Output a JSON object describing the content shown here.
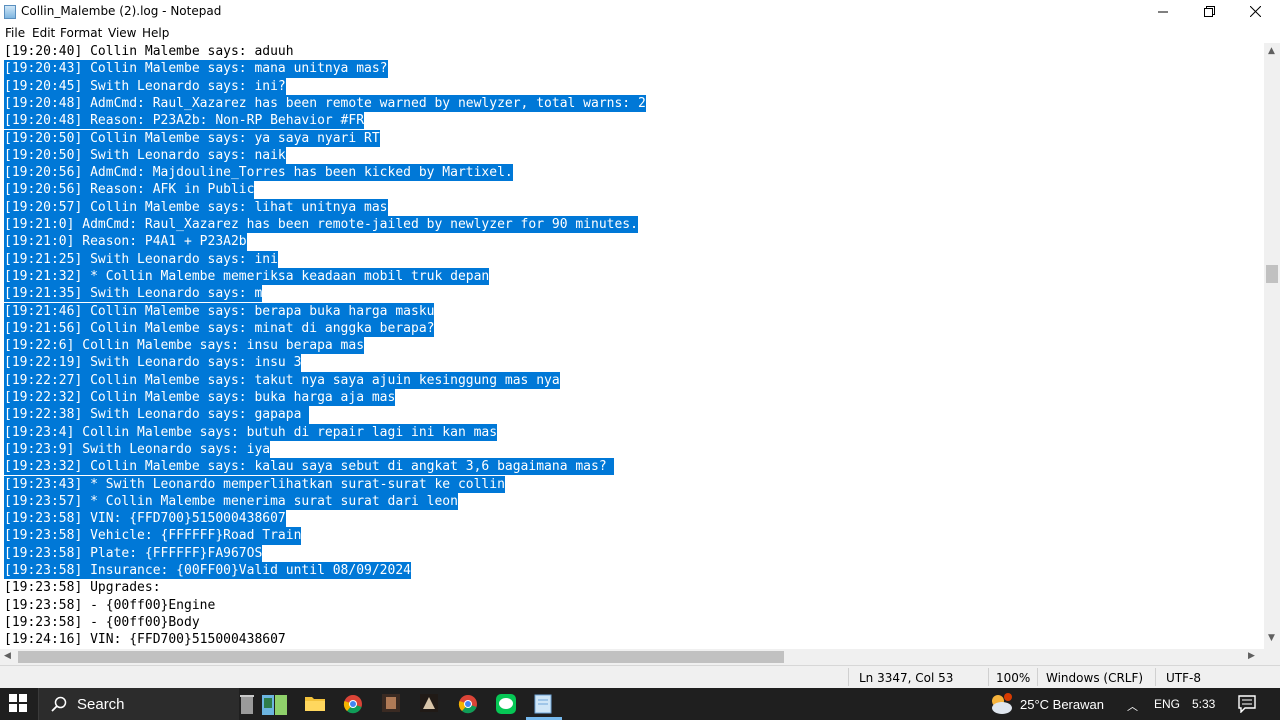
{
  "window": {
    "title": "Collin_Malembe (2).log - Notepad",
    "minimize_icon": "minimize-icon",
    "maximize_icon": "restore-icon",
    "close_icon": "close-icon"
  },
  "menu": [
    "File",
    "Edit",
    "Format",
    "View",
    "Help"
  ],
  "editor": {
    "lines": [
      {
        "text": "[19:20:40] Collin Malembe says: aduuh",
        "selected": false
      },
      {
        "text": "[19:20:43] Collin Malembe says: mana unitnya mas?",
        "selected": true
      },
      {
        "text": "[19:20:45] Swith Leonardo says: ini?",
        "selected": true
      },
      {
        "text": "[19:20:48] AdmCmd: Raul_Xazarez has been remote warned by newlyzer, total warns: 2",
        "selected": true
      },
      {
        "text": "[19:20:48] Reason: P23A2b: Non-RP Behavior #FR",
        "selected": true
      },
      {
        "text": "[19:20:50] Collin Malembe says: ya saya nyari RT",
        "selected": true
      },
      {
        "text": "[19:20:50] Swith Leonardo says: naik",
        "selected": true
      },
      {
        "text": "[19:20:56] AdmCmd: Majdouline_Torres has been kicked by Martixel.",
        "selected": true
      },
      {
        "text": "[19:20:56] Reason: AFK in Public",
        "selected": true
      },
      {
        "text": "[19:20:57] Collin Malembe says: lihat unitnya mas",
        "selected": true
      },
      {
        "text": "[19:21:0] AdmCmd: Raul_Xazarez has been remote-jailed by newlyzer for 90 minutes.",
        "selected": true
      },
      {
        "text": "[19:21:0] Reason: P4A1 + P23A2b",
        "selected": true
      },
      {
        "text": "[19:21:25] Swith Leonardo says: ini",
        "selected": true
      },
      {
        "text": "[19:21:32] * Collin Malembe memeriksa keadaan mobil truk depan",
        "selected": true
      },
      {
        "text": "[19:21:35] Swith Leonardo says: m",
        "selected": true
      },
      {
        "text": "[19:21:46] Collin Malembe says: berapa buka harga masku",
        "selected": true
      },
      {
        "text": "[19:21:56] Collin Malembe says: minat di anggka berapa?",
        "selected": true
      },
      {
        "text": "[19:22:6] Collin Malembe says: insu berapa mas",
        "selected": true
      },
      {
        "text": "[19:22:19] Swith Leonardo says: insu 3",
        "selected": true
      },
      {
        "text": "[19:22:27] Collin Malembe says: takut nya saya ajuin kesinggung mas nya",
        "selected": true
      },
      {
        "text": "[19:22:32] Collin Malembe says: buka harga aja mas",
        "selected": true
      },
      {
        "text": "[19:22:38] Swith Leonardo says: gapapa ",
        "selected": true
      },
      {
        "text": "[19:23:4] Collin Malembe says: butuh di repair lagi ini kan mas",
        "selected": true
      },
      {
        "text": "[19:23:9] Swith Leonardo says: iya",
        "selected": true
      },
      {
        "text": "[19:23:32] Collin Malembe says: kalau saya sebut di angkat 3,6 bagaimana mas? ",
        "selected": true
      },
      {
        "text": "[19:23:43] * Swith Leonardo memperlihatkan surat-surat ke collin",
        "selected": true
      },
      {
        "text": "[19:23:57] * Collin Malembe menerima surat surat dari leon",
        "selected": true
      },
      {
        "text": "[19:23:58] VIN: {FFD700}515000438607",
        "selected": true
      },
      {
        "text": "[19:23:58] Vehicle: {FFFFFF}Road Train",
        "selected": true
      },
      {
        "text": "[19:23:58] Plate: {FFFFFF}FA967OS",
        "selected": true
      },
      {
        "text": "[19:23:58] Insurance: {00FF00}Valid until 08/09/2024",
        "selected": true
      },
      {
        "text": "[19:23:58] Upgrades:",
        "selected": false
      },
      {
        "text": "[19:23:58] - {00ff00}Engine",
        "selected": false
      },
      {
        "text": "[19:23:58] - {00ff00}Body",
        "selected": false
      },
      {
        "text": "[19:24:16] VIN: {FFD700}515000438607",
        "selected": false
      }
    ]
  },
  "status": {
    "position": "Ln 3347, Col 53",
    "zoom": "100%",
    "line_ending": "Windows (CRLF)",
    "encoding": "UTF-8"
  },
  "taskbar": {
    "search_label": "Search",
    "weather": "25°C  Berawan",
    "language": "ENG",
    "time": "5:33",
    "icons": [
      "windows-start-icon",
      "search-icon",
      "trash-icon",
      "book-icon",
      "folder-icon",
      "chrome-icon",
      "game-icon",
      "game2-icon",
      "chrome-alt-icon",
      "line-chat-icon",
      "notepad-icon"
    ]
  },
  "colors": {
    "selection": "#0078d7",
    "taskbar": "#1f1f1f"
  }
}
